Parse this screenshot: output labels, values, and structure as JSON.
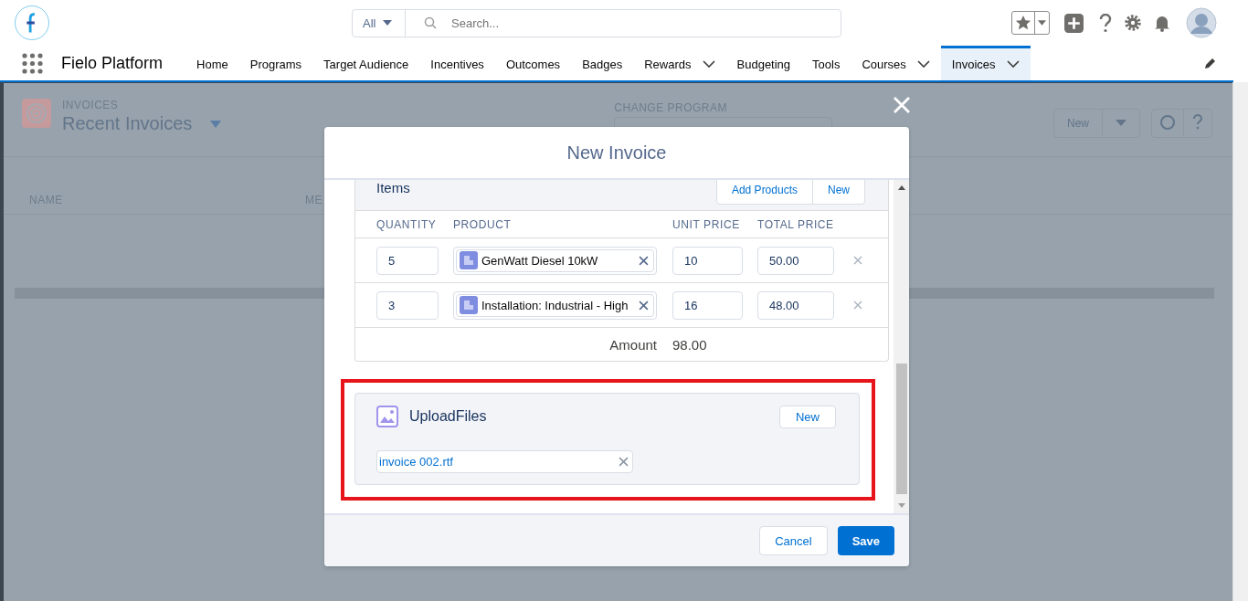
{
  "app": {
    "name": "Fielo Platform"
  },
  "search": {
    "scope": "All",
    "placeholder": "Search..."
  },
  "nav_tabs": [
    {
      "label": "Home",
      "selected": false,
      "has_menu": false
    },
    {
      "label": "Programs",
      "selected": false,
      "has_menu": false
    },
    {
      "label": "Target Audience",
      "selected": false,
      "has_menu": false
    },
    {
      "label": "Incentives",
      "selected": false,
      "has_menu": false
    },
    {
      "label": "Outcomes",
      "selected": false,
      "has_menu": false
    },
    {
      "label": "Badges",
      "selected": false,
      "has_menu": false
    },
    {
      "label": "Rewards",
      "selected": false,
      "has_menu": true
    },
    {
      "label": "Budgeting",
      "selected": false,
      "has_menu": false
    },
    {
      "label": "Tools",
      "selected": false,
      "has_menu": false
    },
    {
      "label": "Courses",
      "selected": false,
      "has_menu": true
    },
    {
      "label": "Invoices",
      "selected": true,
      "has_menu": true
    }
  ],
  "list_view": {
    "object": "INVOICES",
    "title": "Recent Invoices",
    "change_program_label": "CHANGE PROGRAM",
    "new_button": "New",
    "columns": [
      "NAME",
      "ME"
    ]
  },
  "modal": {
    "title": "New Invoice",
    "items": {
      "title": "Items",
      "add_button": "Add Products",
      "new_button": "New",
      "columns": [
        "QUANTITY",
        "PRODUCT",
        "UNIT PRICE",
        "TOTAL PRICE"
      ],
      "rows": [
        {
          "quantity": "5",
          "product": "GenWatt Diesel 10kW",
          "unit_price": "10",
          "total_price": "50.00"
        },
        {
          "quantity": "3",
          "product": "Installation: Industrial - High",
          "unit_price": "16",
          "total_price": "48.00"
        }
      ],
      "amount_label": "Amount",
      "amount": "98.00"
    },
    "upload": {
      "title": "UploadFiles",
      "new_button": "New",
      "highlighted": true,
      "files": [
        "invoice 002.rtf"
      ]
    },
    "cancel_button": "Cancel",
    "save_button": "Save"
  }
}
